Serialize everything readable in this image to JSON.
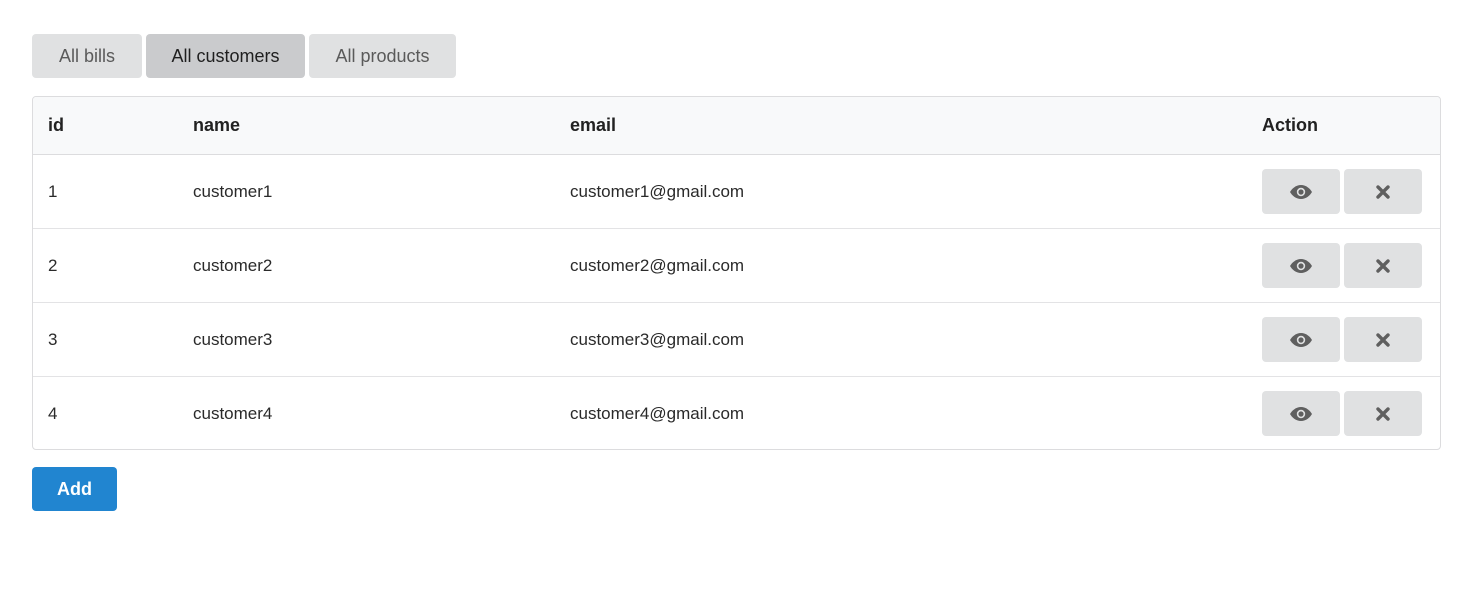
{
  "tabs": [
    {
      "label": "All bills",
      "active": false
    },
    {
      "label": "All customers",
      "active": true
    },
    {
      "label": "All products",
      "active": false
    }
  ],
  "table": {
    "headers": {
      "id": "id",
      "name": "name",
      "email": "email",
      "action": "Action"
    },
    "rows": [
      {
        "id": "1",
        "name": "customer1",
        "email": "customer1@gmail.com"
      },
      {
        "id": "2",
        "name": "customer2",
        "email": "customer2@gmail.com"
      },
      {
        "id": "3",
        "name": "customer3",
        "email": "customer3@gmail.com"
      },
      {
        "id": "4",
        "name": "customer4",
        "email": "customer4@gmail.com"
      }
    ],
    "row_actions": [
      "eye-icon",
      "close-icon"
    ]
  },
  "add_button": {
    "label": "Add"
  },
  "colors": {
    "primary": "#2185d0",
    "button_gray": "#e0e1e2",
    "tab_active": "#cacbcd",
    "header_bg": "#f8f9fa"
  }
}
